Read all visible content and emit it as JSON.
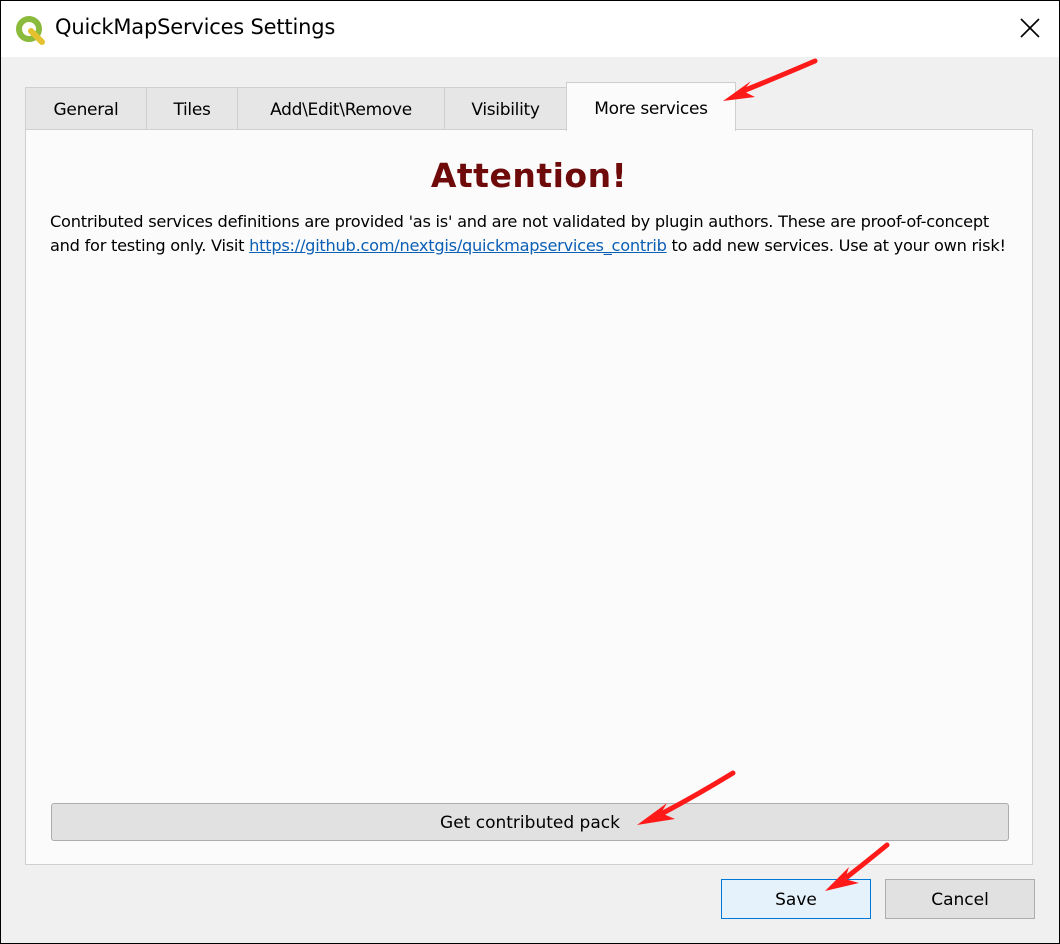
{
  "window": {
    "title": "QuickMapServices Settings",
    "app_icon": "qgis-icon",
    "close_icon": "close-icon"
  },
  "tabs": [
    {
      "label": "General",
      "active": false
    },
    {
      "label": "Tiles",
      "active": false
    },
    {
      "label": "Add\\Edit\\Remove",
      "active": false
    },
    {
      "label": "Visibility",
      "active": false
    },
    {
      "label": "More services",
      "active": true
    }
  ],
  "panel": {
    "heading": "Attention!",
    "notice_before_link": "Contributed services definitions are provided 'as is' and are not validated by plugin authors. These are proof-of-concept and for testing only. Visit ",
    "notice_link": "https://github.com/nextgis/quickmapservices_contrib",
    "notice_after_link": " to add new services. Use at your own risk!",
    "pack_button": "Get contributed pack"
  },
  "footer": {
    "save_label": "Save",
    "cancel_label": "Cancel"
  },
  "colors": {
    "heading": "#6e0a0a",
    "link": "#0b5fb5",
    "annotation_arrow": "#ff1a1a"
  },
  "annotations": [
    "red-arrow",
    "red-arrow",
    "red-arrow"
  ]
}
